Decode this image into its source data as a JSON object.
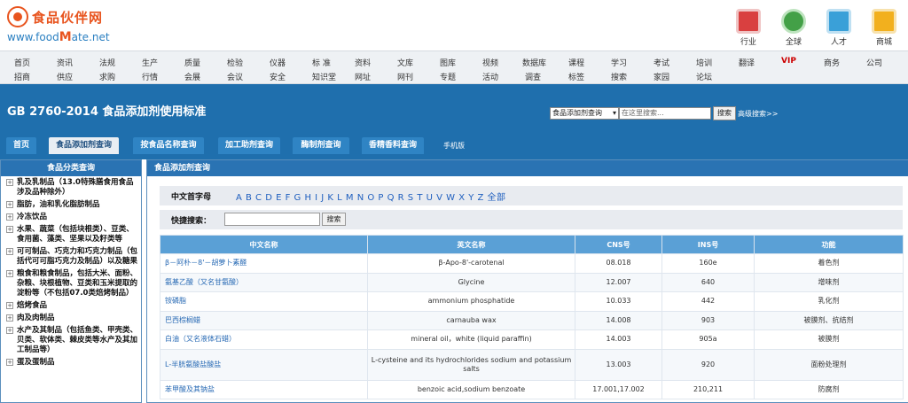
{
  "header": {
    "logo_cn": "食品伙伴网",
    "logo_en_prefix": "www.food",
    "logo_en_mark": "M",
    "logo_en_suffix": "ate.net",
    "icons": [
      {
        "label": "行业",
        "icon": "home-icon",
        "color": "#d94040"
      },
      {
        "label": "全球",
        "icon": "globe-icon",
        "color": "#43a047"
      },
      {
        "label": "人才",
        "icon": "people-icon",
        "color": "#3aa0d8"
      },
      {
        "label": "商城",
        "icon": "cart-icon",
        "color": "#f2b01e"
      }
    ]
  },
  "nav": {
    "row1": [
      "首页",
      "资讯",
      "法规",
      "生产",
      "质量",
      "检验",
      "仪器",
      "标 准",
      "资料",
      "文库",
      "图库",
      "视频",
      "数据库",
      "课程",
      "学习",
      "考试",
      "培训",
      "翻译",
      "VIP",
      "商务",
      "公司"
    ],
    "row2": [
      "招商",
      "供应",
      "求购",
      "行情",
      "会展",
      "会议",
      "安全",
      "知识堂",
      "网址",
      "网刊",
      "专题",
      "活动",
      "调查",
      "标签",
      "搜索",
      "家园",
      "论坛"
    ]
  },
  "banner": {
    "title": "GB 2760-2014 食品添加剂使用标准",
    "search_select": "食品添加剂查询",
    "search_placeholder": "在这里搜索...",
    "search_button": "搜索",
    "advanced_search": "高级搜索>>"
  },
  "tabs": [
    "首页",
    "食品添加剂查询",
    "按食品名称查询",
    "加工助剂查询",
    "酶制剂查询",
    "香精香料查询",
    "手机版"
  ],
  "active_tab": "食品添加剂查询",
  "sidebar": {
    "title": "食品分类查询",
    "items": [
      "乳及乳制品（13.0特殊膳食用食品涉及品种除外）",
      "脂肪，油和乳化脂肪制品",
      "冷冻饮品",
      "水果、蔬菜（包括块根类）、豆类、食用菌、藻类、坚果以及籽类等",
      "可可制品、巧克力和巧克力制品（包括代可可脂巧克力及制品）以及糖果",
      "粮食和粮食制品，包括大米、面粉、杂粮、块根植物、豆类和玉米提取的淀粉等（不包括07.0类焙烤制品）",
      "焙烤食品",
      "肉及肉制品",
      "水产及其制品（包括鱼类、甲壳类、贝类、软体类、棘皮类等水产及其加工制品等）",
      "蛋及蛋制品"
    ]
  },
  "content": {
    "title": "食品添加剂查询",
    "letters_label": "中文首字母",
    "letters": "A B C D E F G H I J K L M N O P Q R S T U V W X Y Z 全部",
    "quick_label": "快捷搜索：",
    "quick_button": "搜索",
    "columns": [
      "中文名称",
      "英文名称",
      "CNS号",
      "INS号",
      "功能"
    ],
    "rows": [
      [
        "β－阿朴－8'－胡萝卜素醛",
        "β-Apo-8'-carotenal",
        "08.018",
        "160e",
        "着色剂"
      ],
      [
        "氨基乙酸（又名甘氨酸）",
        "Glycine",
        "12.007",
        "640",
        "增味剂"
      ],
      [
        "铵磷脂",
        "ammonium phosphatide",
        "10.033",
        "442",
        "乳化剂"
      ],
      [
        "巴西棕榈蜡",
        "carnauba wax",
        "14.008",
        "903",
        "被膜剂、抗结剂"
      ],
      [
        "白油（又名液体石蜡）",
        "mineral oil，white (liquid paraffin)",
        "14.003",
        "905a",
        "被膜剂"
      ],
      [
        "L-半胱氨酸盐酸盐",
        "L-cysteine and its hydrochlorides sodium and potassium salts",
        "13.003",
        "920",
        "面粉处理剂"
      ],
      [
        "苯甲酸及其钠盐",
        "benzoic acid,sodium benzoate",
        "17.001,17.002",
        "210,211",
        "防腐剂"
      ]
    ]
  }
}
